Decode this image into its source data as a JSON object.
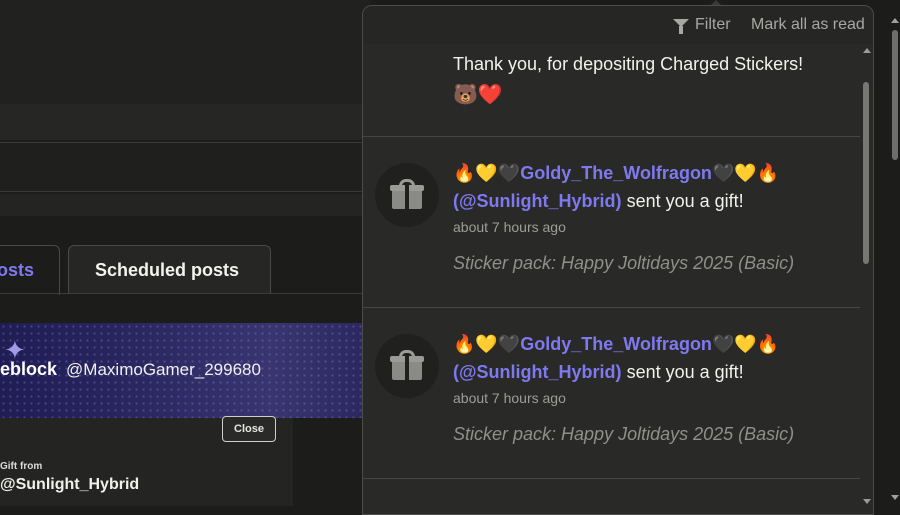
{
  "background": {
    "tabs": [
      {
        "label": "osts",
        "active": true
      },
      {
        "label": "Scheduled posts",
        "active": false
      }
    ],
    "banner": {
      "name": "eblock",
      "handle": "@MaximoGamer_299680"
    },
    "gift_dialog": {
      "close_label": "Close",
      "from_label": "Gift from",
      "from_handle": "@Sunlight_Hybrid"
    }
  },
  "notifications": {
    "header": {
      "filter_label": "Filter",
      "mark_all_label": "Mark all as read"
    },
    "items": [
      {
        "text": "Thank you, for depositing Charged Stickers!",
        "emoji": "🐻❤️"
      },
      {
        "prefix_emoji": "🔥💛🖤",
        "username": "Goldy_The_Wolfragon",
        "suffix_emoji": "🖤💛🔥",
        "handle": "(@Sunlight_Hybrid)",
        "action": "sent you a gift!",
        "time": "about 7 hours ago",
        "detail": "Sticker pack: Happy Joltidays 2025 (Basic)"
      },
      {
        "prefix_emoji": "🔥💛🖤",
        "username": "Goldy_The_Wolfragon",
        "suffix_emoji": "🖤💛🔥",
        "handle": "(@Sunlight_Hybrid)",
        "action": "sent you a gift!",
        "time": "about 7 hours ago",
        "detail": "Sticker pack: Happy Joltidays 2025 (Basic)"
      }
    ]
  },
  "icons": {
    "filter": "filter-icon",
    "gift": "gift-icon",
    "sparkle": "sparkle-icon"
  },
  "colors": {
    "accent": "#7f79f0",
    "background": "#1c1c1b",
    "panel": "#292927"
  }
}
